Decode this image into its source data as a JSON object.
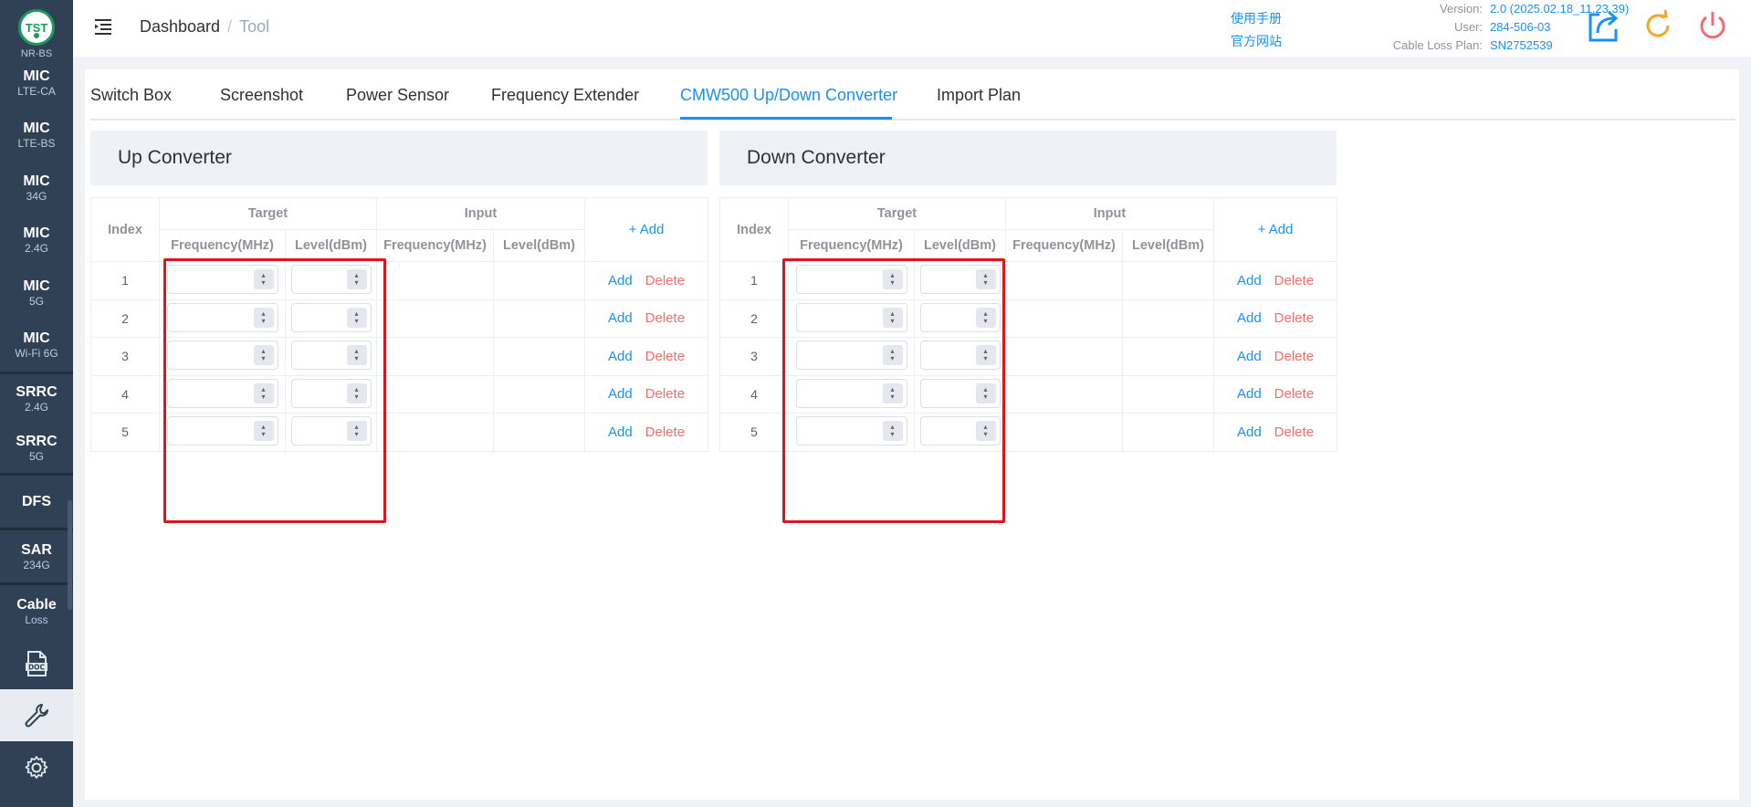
{
  "sidebar": {
    "logo_text": "TST",
    "cut_label": "NR-BS",
    "mic_items": [
      {
        "main": "MIC",
        "sub": "LTE-CA"
      },
      {
        "main": "MIC",
        "sub": "LTE-BS"
      },
      {
        "main": "MIC",
        "sub": "34G"
      },
      {
        "main": "MIC",
        "sub": "2.4G"
      },
      {
        "main": "MIC",
        "sub": "5G"
      },
      {
        "main": "MIC",
        "sub": "Wi-Fi 6G"
      }
    ],
    "srrc_items": [
      {
        "main": "SRRC",
        "sub": "2.4G"
      },
      {
        "main": "SRRC",
        "sub": "5G"
      }
    ],
    "dfs": "DFS",
    "sar": {
      "main": "SAR",
      "sub": "234G"
    },
    "cable": {
      "main": "Cable",
      "sub": "Loss"
    },
    "doc_icon_text": "DOC"
  },
  "header": {
    "breadcrumb": [
      "Dashboard",
      "Tool"
    ],
    "breadcrumb_sep": "/",
    "link_manual": "使用手册",
    "link_site": "官方网站",
    "version_label": "Version:",
    "version_value": "2.0 (2025.02.18_11.23.39)",
    "user_label": "User:",
    "user_value": "284-506-03",
    "plan_label": "Cable Loss Plan:",
    "plan_value": "SN2752539"
  },
  "tabs": [
    "Switch Box",
    "Screenshot",
    "Power Sensor",
    "Frequency Extender",
    "CMW500 Up/Down Converter",
    "Import Plan"
  ],
  "up": {
    "title": "Up Converter",
    "col_index": "Index",
    "col_target": "Target",
    "col_input": "Input",
    "col_freq": "Frequency(MHz)",
    "col_level": "Level(dBm)",
    "add_header": "+ Add",
    "rows": [
      "1",
      "2",
      "3",
      "4",
      "5"
    ],
    "row_add": "Add",
    "row_delete": "Delete"
  },
  "down": {
    "title": "Down Converter",
    "col_index": "Index",
    "col_target": "Target",
    "col_input": "Input",
    "col_freq": "Frequency(MHz)",
    "col_level": "Level(dBm)",
    "add_header": "+ Add",
    "rows": [
      "1",
      "2",
      "3",
      "4",
      "5"
    ],
    "row_add": "Add",
    "row_delete": "Delete"
  },
  "colors": {
    "sidebar_bg": "#304156",
    "accent": "#1890ff",
    "danger": "#f56c6c",
    "highlight_box": "#e0141e",
    "logo_green": "#1b9a5c"
  }
}
